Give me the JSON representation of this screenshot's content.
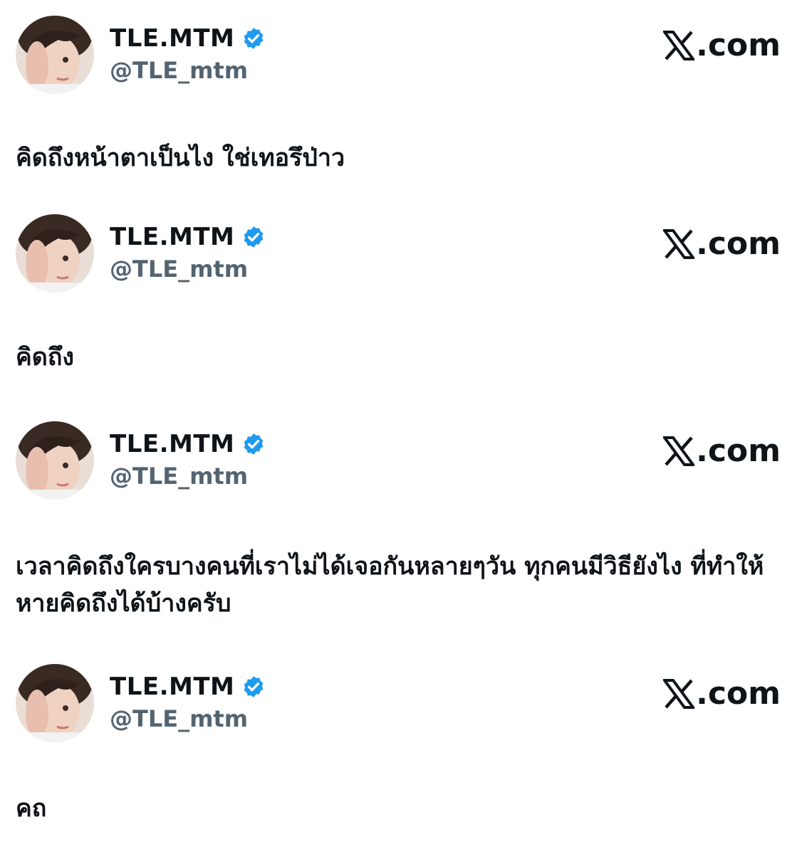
{
  "brand": {
    "icon": "x-logo-icon",
    "text": ".com"
  },
  "accent_colors": {
    "verified": "#1d9bf0",
    "handle": "#536471",
    "text": "#0f1419"
  },
  "posts": [
    {
      "display_name": "TLE.MTM",
      "handle": "@TLE_mtm",
      "verified": true,
      "text": "คิดถึงหน้าตาเป็นไง ใช่เทอรึป่าว"
    },
    {
      "display_name": "TLE.MTM",
      "handle": "@TLE_mtm",
      "verified": true,
      "text": "คิดถึง"
    },
    {
      "display_name": "TLE.MTM",
      "handle": "@TLE_mtm",
      "verified": true,
      "text": "เวลาคิดถึงใครบางคนที่เราไม่ได้เจอกันหลายๆวัน ทุกคนมีวิธียังไง ที่ทำให้หายคิดถึงได้บ้างครับ"
    },
    {
      "display_name": "TLE.MTM",
      "handle": "@TLE_mtm",
      "verified": true,
      "text": "คถ"
    }
  ]
}
